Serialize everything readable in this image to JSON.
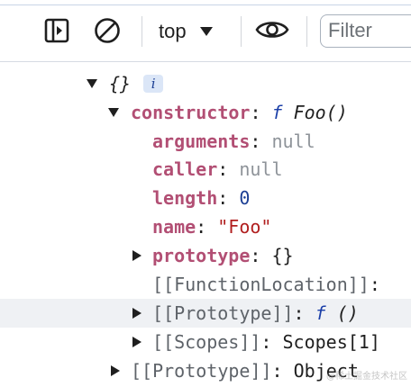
{
  "toolbar": {
    "context_label": "top",
    "filter_placeholder": "Filter"
  },
  "tree": {
    "root": {
      "label": "{}",
      "info_badge": "i"
    },
    "constructor": {
      "key": "constructor",
      "func_keyword": "f",
      "func_name": "Foo()"
    },
    "props": [
      {
        "key": "arguments",
        "value": "null"
      },
      {
        "key": "caller",
        "value": "null"
      },
      {
        "key": "length",
        "value": "0"
      },
      {
        "key": "name",
        "value": "\"Foo\""
      }
    ],
    "prototype": {
      "key": "prototype",
      "value": "{}"
    },
    "function_location": {
      "key": "[[FunctionLocation]]"
    },
    "inner_prototype": {
      "key": "[[Prototype]]",
      "func_keyword": "f",
      "func_name": "()"
    },
    "scopes": {
      "key": "[[Scopes]]",
      "value": "Scopes[1]"
    },
    "outer_prototype": {
      "key": "[[Prototype]]",
      "value": "Object"
    }
  },
  "watermark": "@稀土掘金技术社区"
}
